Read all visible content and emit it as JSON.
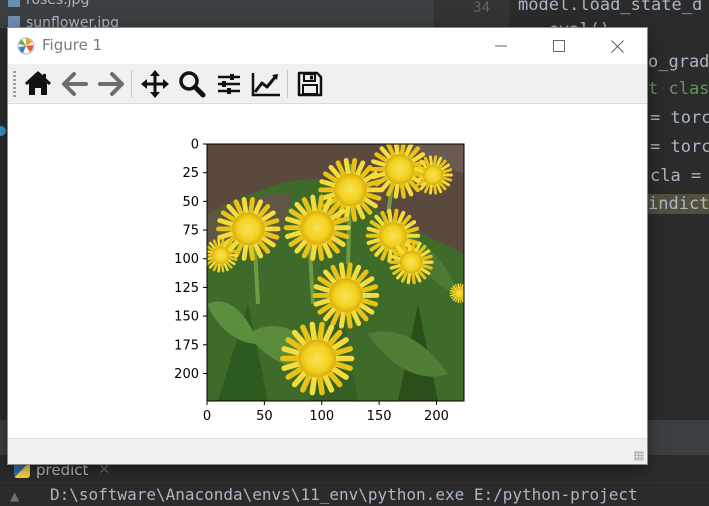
{
  "ide": {
    "files": [
      "roses.jpg",
      "sunflower.jpg"
    ],
    "line_number": "34",
    "code_lines": [
      "model.load_state_d",
      "  .eval()",
      "o_grad",
      "t clas",
      "= torch",
      "= torc",
      "cla =",
      "indict"
    ],
    "run_tab": "predict",
    "console_text": "D:\\software\\Anaconda\\envs\\11_env\\python.exe E:/python-project"
  },
  "figure": {
    "title": "Figure 1",
    "toolbar": [
      {
        "name": "home-icon"
      },
      {
        "name": "back-arrow-icon"
      },
      {
        "name": "forward-arrow-icon"
      },
      {
        "name": "pan-icon"
      },
      {
        "name": "zoom-icon"
      },
      {
        "name": "subplots-icon"
      },
      {
        "name": "edit-axis-icon"
      },
      {
        "name": "save-icon"
      }
    ]
  },
  "chart_data": {
    "type": "image",
    "content": "photo of yellow dandelion flowers with green leaves",
    "xlim": [
      0,
      224
    ],
    "ylim": [
      224,
      0
    ],
    "xticks": [
      "0",
      "50",
      "100",
      "150",
      "200"
    ],
    "xtick_values": [
      0,
      50,
      100,
      150,
      200
    ],
    "yticks": [
      "0",
      "25",
      "50",
      "75",
      "100",
      "125",
      "150",
      "175",
      "200"
    ],
    "ytick_values": [
      0,
      25,
      50,
      75,
      100,
      125,
      150,
      175,
      200
    ],
    "colors": {
      "petals": "#f3d21e",
      "leaves": "#3e6a2a",
      "soil": "#5a4a3e"
    }
  }
}
